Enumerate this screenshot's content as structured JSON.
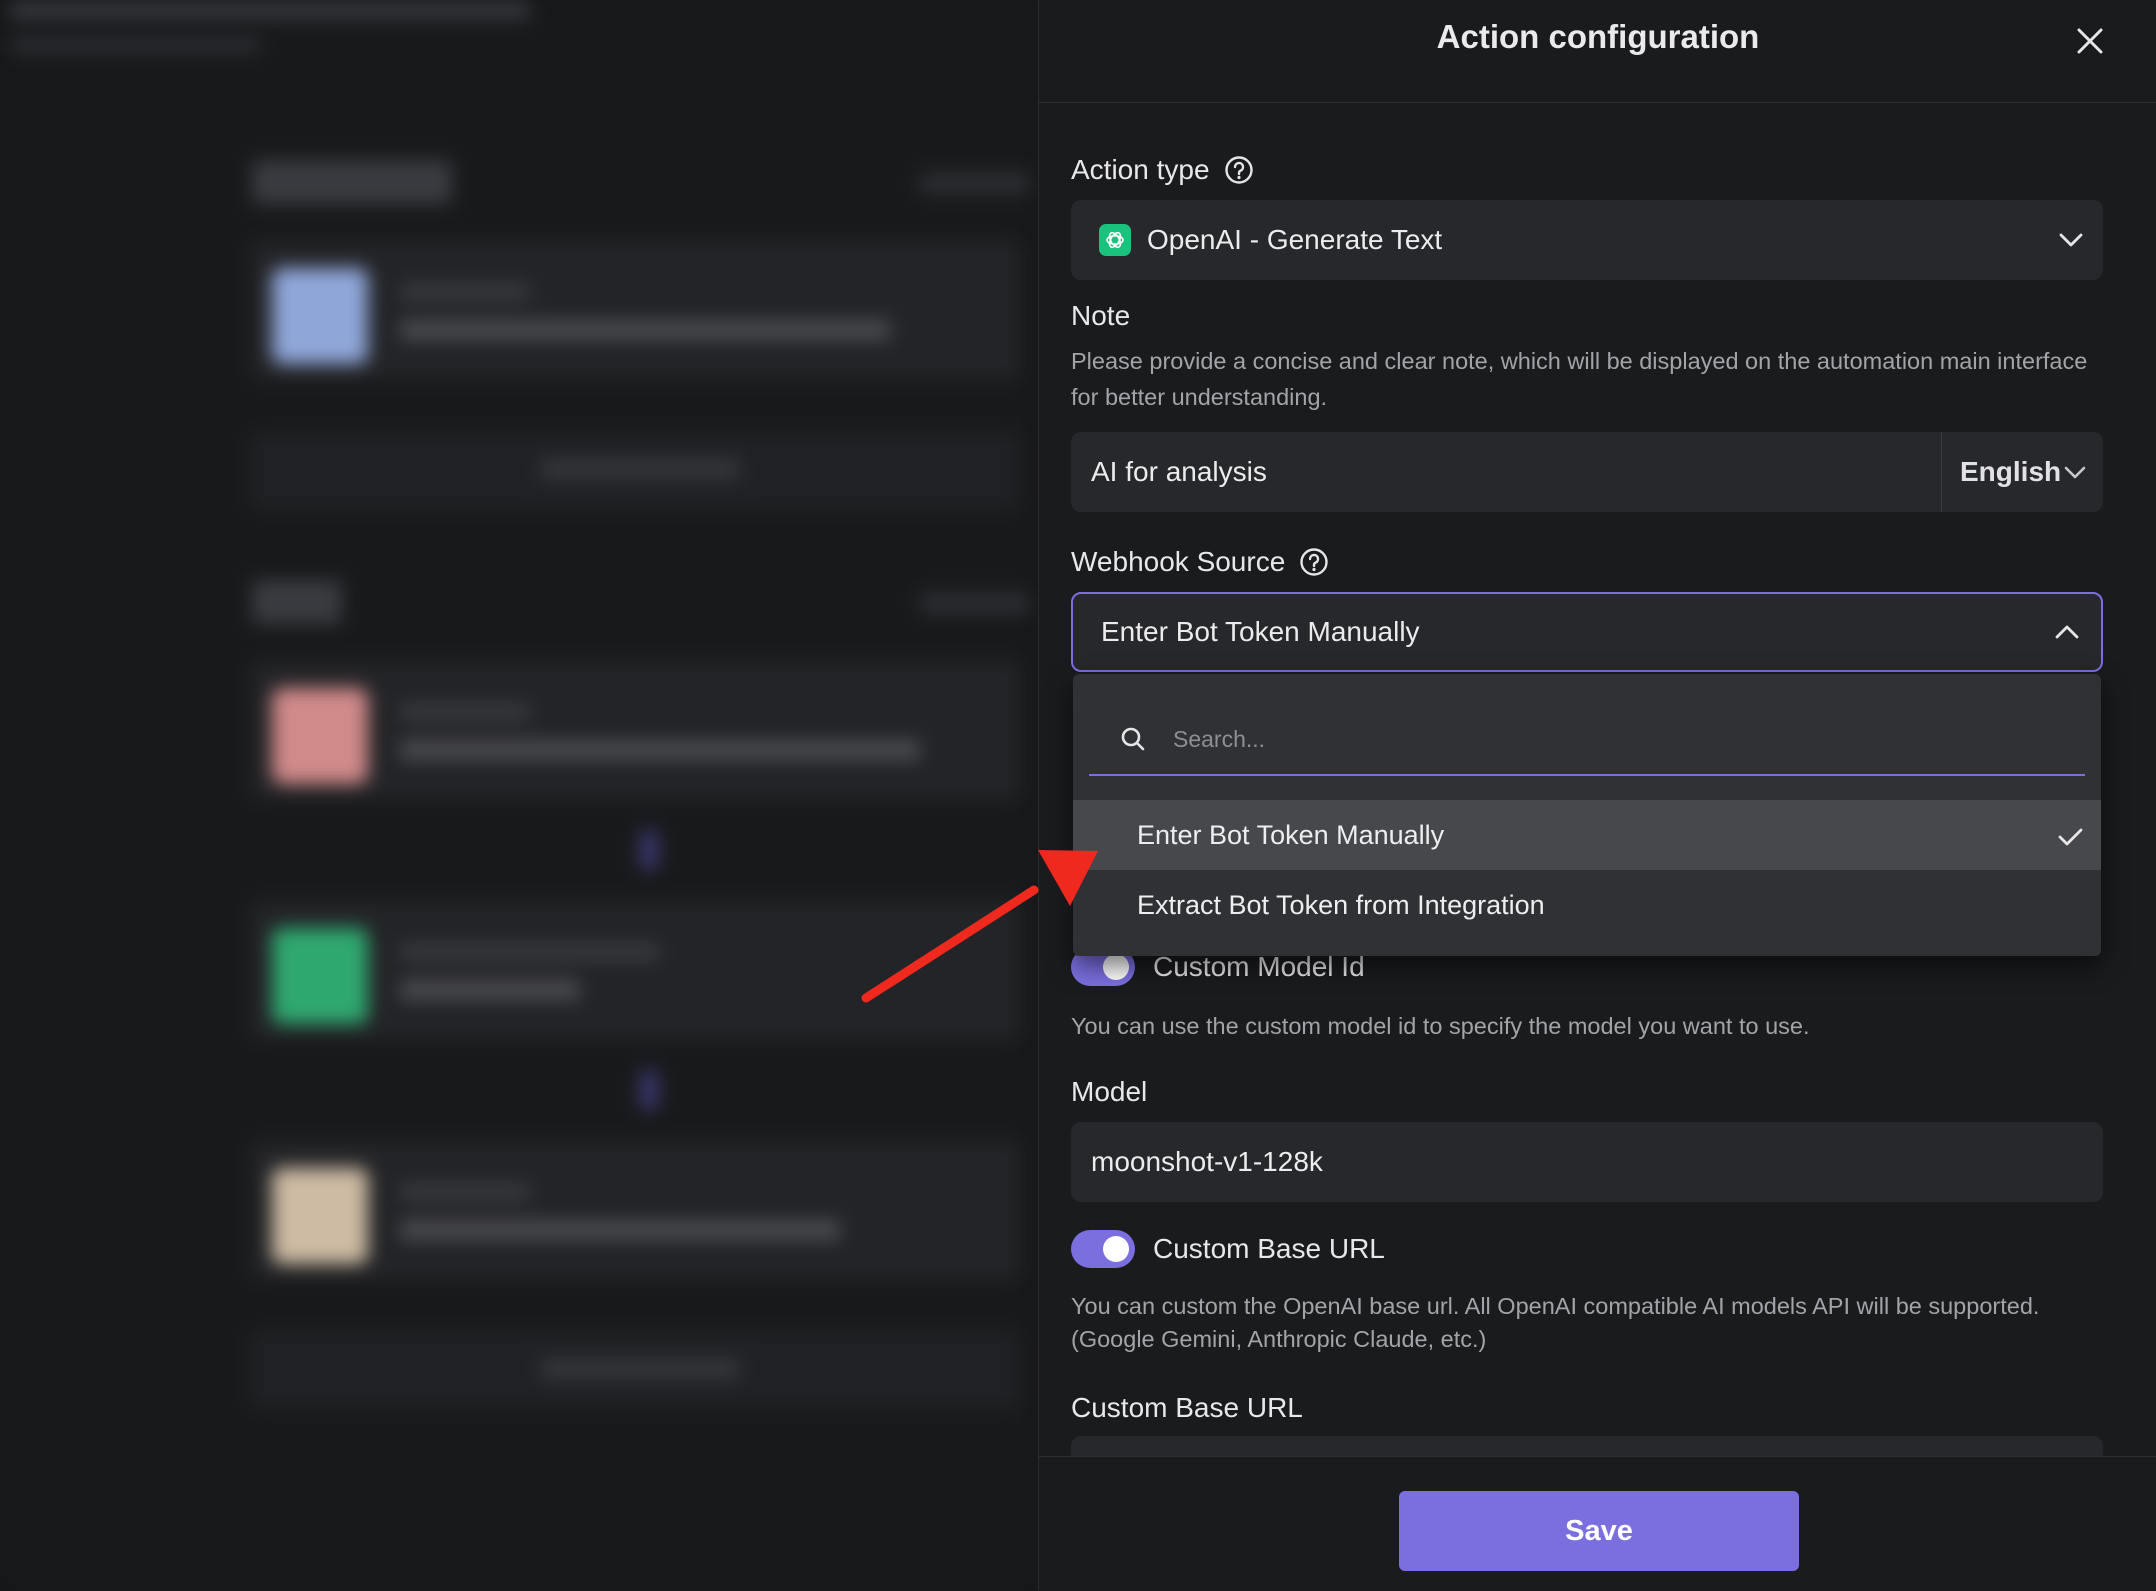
{
  "panel": {
    "title": "Action configuration"
  },
  "action_type": {
    "label": "Action type",
    "value": "OpenAI - Generate Text",
    "icon": "openai-logo-icon"
  },
  "note": {
    "label": "Note",
    "description": "Please provide a concise and clear note, which will be displayed on the automation main interface for better understanding.",
    "value": "AI for analysis",
    "language": "English"
  },
  "webhook_source": {
    "label": "Webhook Source",
    "selected": "Enter Bot Token Manually",
    "search_placeholder": "Search...",
    "options": [
      "Enter Bot Token Manually",
      "Extract Bot Token from Integration"
    ]
  },
  "custom_model_id": {
    "label": "Custom Model Id",
    "enabled": true,
    "description": "You can use the custom model id to specify the model you want to use."
  },
  "model": {
    "label": "Model",
    "value": "moonshot-v1-128k"
  },
  "custom_base_url": {
    "toggle_label": "Custom Base URL",
    "enabled": true,
    "description_line1": "You can custom the OpenAI base url. All OpenAI compatible AI models API will be supported.",
    "description_line2": "(Google Gemini, Anthropic Claude, etc.)",
    "field_label": "Custom Base URL"
  },
  "footer": {
    "save_label": "Save"
  },
  "colors": {
    "accent": "#7b6fe0",
    "openai_green": "#19c37d",
    "annotation_arrow": "#f0291f"
  }
}
